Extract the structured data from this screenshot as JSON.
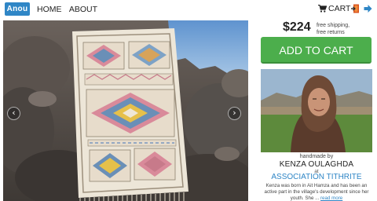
{
  "header": {
    "logo_text": "Anou",
    "nav": [
      "HOME",
      "ABOUT"
    ],
    "cart_label": "CART",
    "icons": [
      "cart-icon",
      "exit-door-icon",
      "arrow-right-icon"
    ]
  },
  "product": {
    "prev_glyph": "‹",
    "next_glyph": "›"
  },
  "purchase": {
    "price": "$224",
    "shipping_line1": "free shipping,",
    "shipping_line2": "free returns",
    "add_to_cart_label": "ADD TO CART"
  },
  "artisan": {
    "handmade_by": "handmade by",
    "name": "KENZA OULAGHDA",
    "at": "at",
    "association": "ASSOCIATION TITHRITE",
    "bio_line1": "Kenza was born in Ait Hamza and has been an",
    "bio_line2": "active part in the village's development since her",
    "bio_line3": "youth. She ...",
    "read_more": "read more"
  },
  "colors": {
    "brand_blue": "#2f86c6",
    "add_cart_green": "#4cae4c"
  }
}
